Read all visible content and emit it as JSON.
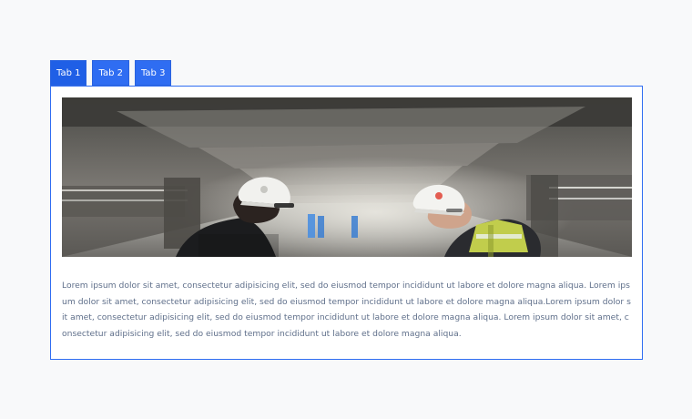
{
  "tabs": [
    {
      "label": "Tab 1",
      "active": true
    },
    {
      "label": "Tab 2",
      "active": false
    },
    {
      "label": "Tab 3",
      "active": false
    }
  ],
  "panel": {
    "body_text": "Lorem ipsum dolor sit amet, consectetur adipisicing elit, sed do eiusmod tempor incididunt ut labore et dolore magna aliqua. Lorem ipsum dolor sit amet, consectetur adipisicing elit, sed do eiusmod tempor incididunt ut labore et dolore magna aliqua.Lorem ipsum dolor sit amet, consectetur adipisicing elit, sed do eiusmod tempor incididunt ut labore et dolore magna aliqua. Lorem ipsum dolor sit amet, consectetur adipisicing elit, sed do eiusmod tempor incididunt ut labore et dolore magna aliqua."
  },
  "colors": {
    "tab_bg": "#2f6df2",
    "tab_text": "#ffffff",
    "panel_border": "#2f6df2",
    "body_text": "#5f6f8a",
    "page_bg": "#f8f9fa"
  },
  "image": {
    "subject": "two-construction-workers-in-hard-hats-inside-parking-garage"
  }
}
